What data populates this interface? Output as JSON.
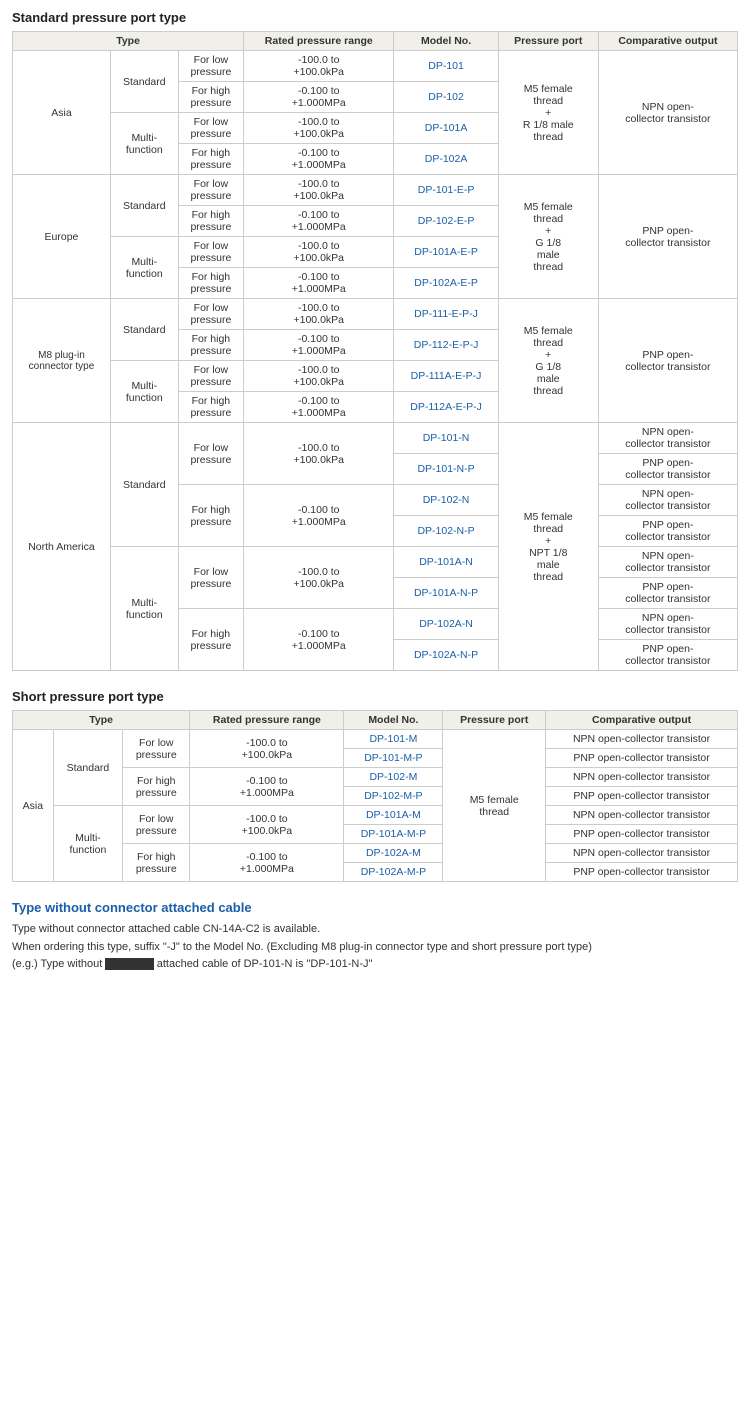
{
  "page": {
    "section1_title": "Standard pressure port type",
    "section2_title": "Short pressure port type",
    "section3_title": "Type without connector attached cable",
    "section3_body": [
      "Type without connector attached cable CN-14A-C2 is available.",
      "When ordering this type, suffix \"-J\" to the Model No. (Excluding M8 plug-in connector type and short pressure port type)",
      "(e.g.) Type without connector attached cable of DP-101-N is \"DP-101-N-J\""
    ]
  },
  "table1_headers": [
    "Type",
    "",
    "",
    "Rated pressure range",
    "Model No.",
    "Pressure port",
    "Comparative output"
  ],
  "table2_headers": [
    "Type",
    "",
    "",
    "Rated pressure range",
    "Model No.",
    "Pressure port",
    "Comparative output"
  ],
  "standard_table": {
    "rows": [
      {
        "region": "Asia",
        "type": "Standard",
        "pressure": "For low pressure",
        "range": "-100.0 to +100.0kPa",
        "model": "DP-101",
        "port": "M5 female thread + R 1/8 male thread",
        "output": "NPN open-collector transistor"
      },
      {
        "region": "",
        "type": "",
        "pressure": "For high pressure",
        "range": "-0.100 to +1.000MPa",
        "model": "DP-102",
        "port": "",
        "output": ""
      },
      {
        "region": "",
        "type": "Multi-function",
        "pressure": "For low pressure",
        "range": "-100.0 to +100.0kPa",
        "model": "DP-101A",
        "port": "",
        "output": ""
      },
      {
        "region": "",
        "type": "",
        "pressure": "For high pressure",
        "range": "-0.100 to +1.000MPa",
        "model": "DP-102A",
        "port": "",
        "output": ""
      },
      {
        "region": "Europe",
        "type": "Standard",
        "pressure": "For low pressure",
        "range": "-100.0 to +100.0kPa",
        "model": "DP-101-E-P",
        "port": "M5 female thread + G 1/8 male thread",
        "output": "PNP open-collector transistor"
      },
      {
        "region": "",
        "type": "",
        "pressure": "For high pressure",
        "range": "-0.100 to +1.000MPa",
        "model": "DP-102-E-P",
        "port": "",
        "output": ""
      },
      {
        "region": "",
        "type": "Multi-function",
        "pressure": "For low pressure",
        "range": "-100.0 to +100.0kPa",
        "model": "DP-101A-E-P",
        "port": "",
        "output": ""
      },
      {
        "region": "",
        "type": "",
        "pressure": "For high pressure",
        "range": "-0.100 to +1.000MPa",
        "model": "DP-102A-E-P",
        "port": "",
        "output": ""
      },
      {
        "region": "M8 plug-in connector type",
        "type": "Standard",
        "pressure": "For low pressure",
        "range": "-100.0 to +100.0kPa",
        "model": "DP-111-E-P-J",
        "port": "M5 female thread + G 1/8 male thread",
        "output": "PNP open-collector transistor"
      },
      {
        "region": "",
        "type": "",
        "pressure": "For high pressure",
        "range": "-0.100 to +1.000MPa",
        "model": "DP-112-E-P-J",
        "port": "",
        "output": ""
      },
      {
        "region": "",
        "type": "Multi-function",
        "pressure": "For low pressure",
        "range": "-100.0 to +100.0kPa",
        "model": "DP-111A-E-P-J",
        "port": "",
        "output": ""
      },
      {
        "region": "",
        "type": "",
        "pressure": "For high pressure",
        "range": "-0.100 to +1.000MPa",
        "model": "DP-112A-E-P-J",
        "port": "",
        "output": ""
      },
      {
        "region": "North America",
        "type": "Standard",
        "pressure": "For low pressure",
        "range": "-100.0 to +100.0kPa",
        "model": "DP-101-N",
        "port": "M5 female thread + NPT 1/8 male thread",
        "output": "NPN open-collector transistor"
      },
      {
        "region": "",
        "type": "",
        "pressure": "",
        "range": "",
        "model": "DP-101-N-P",
        "port": "",
        "output": "PNP open-collector transistor"
      },
      {
        "region": "",
        "type": "",
        "pressure": "For high pressure",
        "range": "-0.100 to +1.000MPa",
        "model": "DP-102-N",
        "port": "",
        "output": "NPN open-collector transistor"
      },
      {
        "region": "",
        "type": "",
        "pressure": "",
        "range": "",
        "model": "DP-102-N-P",
        "port": "",
        "output": "PNP open-collector transistor"
      },
      {
        "region": "",
        "type": "Multi-function",
        "pressure": "For low pressure",
        "range": "-100.0 to +100.0kPa",
        "model": "DP-101A-N",
        "port": "",
        "output": "NPN open-collector transistor"
      },
      {
        "region": "",
        "type": "",
        "pressure": "",
        "range": "",
        "model": "DP-101A-N-P",
        "port": "",
        "output": "PNP open-collector transistor"
      },
      {
        "region": "",
        "type": "",
        "pressure": "For high pressure",
        "range": "-0.100 to +1.000MPa",
        "model": "DP-102A-N",
        "port": "",
        "output": "NPN open-collector transistor"
      },
      {
        "region": "",
        "type": "",
        "pressure": "",
        "range": "",
        "model": "DP-102A-N-P",
        "port": "",
        "output": "PNP open-collector transistor"
      }
    ]
  },
  "short_table": {
    "rows": [
      {
        "region": "Asia",
        "type": "Standard",
        "pressure": "For low pressure",
        "range": "-100.0 to +100.0kPa",
        "model": "DP-101-M",
        "port": "M5 female thread",
        "output": "NPN open-collector transistor"
      },
      {
        "model": "DP-101-M-P",
        "output": "PNP open-collector transistor"
      },
      {
        "pressure": "For high pressure",
        "range": "-0.100 to +1.000MPa",
        "model": "DP-102-M",
        "output": "NPN open-collector transistor"
      },
      {
        "model": "DP-102-M-P",
        "output": "PNP open-collector transistor"
      },
      {
        "type": "Multi-function",
        "pressure": "For low pressure",
        "range": "-100.0 to +100.0kPa",
        "model": "DP-101A-M",
        "output": "NPN open-collector transistor"
      },
      {
        "model": "DP-101A-M-P",
        "output": "PNP open-collector transistor"
      },
      {
        "pressure": "For high pressure",
        "range": "-0.100 to +1.000MPa",
        "model": "DP-102A-M",
        "output": "NPN open-collector transistor"
      },
      {
        "model": "DP-102A-M-P",
        "output": "PNP open-collector transistor"
      }
    ]
  }
}
